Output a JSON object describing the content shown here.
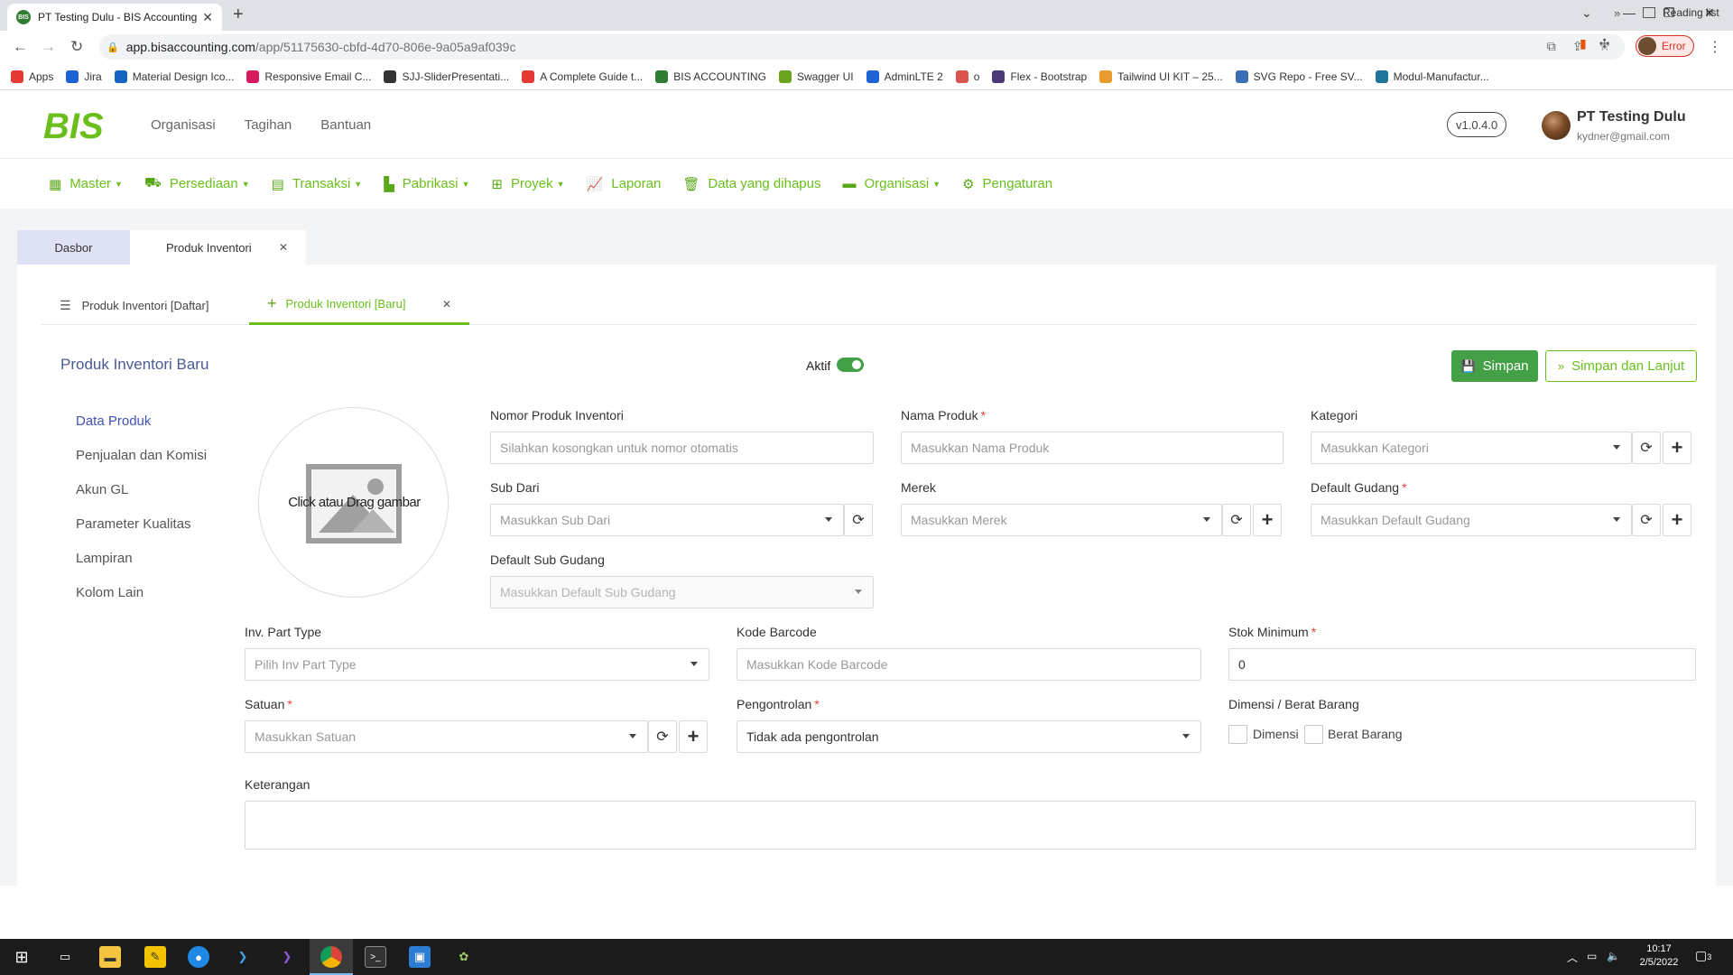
{
  "browser": {
    "tab_title": "PT Testing Dulu - BIS Accounting",
    "favicon_text": "BIS",
    "url_host": "app.bisaccounting.com",
    "url_path": "/app/51175630-cbfd-4d70-806e-9a05a9af039c",
    "profile_status": "Error",
    "bookmarks": [
      {
        "label": "Apps",
        "color": "#e53935"
      },
      {
        "label": "Jira",
        "color": "#1e63d6"
      },
      {
        "label": "Material Design Ico...",
        "color": "#1565c0"
      },
      {
        "label": "Responsive Email C...",
        "color": "#d81b60"
      },
      {
        "label": "SJJ-SliderPresentati...",
        "color": "#333333"
      },
      {
        "label": "A Complete Guide t...",
        "color": "#e53935"
      },
      {
        "label": "BIS ACCOUNTING",
        "color": "#2e7d32"
      },
      {
        "label": "Swagger UI",
        "color": "#6aa41e"
      },
      {
        "label": "AdminLTE 2",
        "color": "#1e63d6"
      },
      {
        "label": "o",
        "color": "#d9534f"
      },
      {
        "label": "Flex - Bootstrap",
        "color": "#4a3a78"
      },
      {
        "label": "Tailwind UI KIT – 25...",
        "color": "#e89a2b"
      },
      {
        "label": "SVG Repo - Free SV...",
        "color": "#3c6eb4"
      },
      {
        "label": "Modul-Manufactur...",
        "color": "#21759b"
      }
    ],
    "reading_list": "Reading list"
  },
  "app": {
    "logo_text": "BIS",
    "top_nav": [
      "Organisasi",
      "Tagihan",
      "Bantuan"
    ],
    "version": "v1.0.4.0",
    "user": {
      "name": "PT Testing Dulu",
      "email": "kydner@gmail.com"
    },
    "accent_color": "#6abf1c",
    "menu": [
      {
        "label": "Master",
        "icon": "grid-icon",
        "glyph": "▦",
        "dropdown": true
      },
      {
        "label": "Persediaan",
        "icon": "cubes-icon",
        "glyph": "⛟",
        "dropdown": true
      },
      {
        "label": "Transaksi",
        "icon": "register-icon",
        "glyph": "▤",
        "dropdown": true
      },
      {
        "label": "Pabrikasi",
        "icon": "industry-icon",
        "glyph": "▙",
        "dropdown": true
      },
      {
        "label": "Proyek",
        "icon": "sitemap-icon",
        "glyph": "⊞",
        "dropdown": true
      },
      {
        "label": "Laporan",
        "icon": "line-chart-icon",
        "glyph": "📈",
        "dropdown": false
      },
      {
        "label": "Data yang dihapus",
        "icon": "trash-icon",
        "glyph": "🗑",
        "dropdown": false
      },
      {
        "label": "Organisasi",
        "icon": "building-icon",
        "glyph": "▬",
        "dropdown": true
      },
      {
        "label": "Pengaturan",
        "icon": "gear-icon",
        "glyph": "⚙",
        "dropdown": false
      }
    ],
    "page_tabs": {
      "dasbor": "Dasbor",
      "produk": "Produk Inventori"
    },
    "sub_tabs": {
      "list": "Produk Inventori [Daftar]",
      "new": "Produk Inventori [Baru]"
    }
  },
  "form": {
    "title": "Produk Inventori Baru",
    "aktif_label": "Aktif",
    "aktif_on": true,
    "save_label": "Simpan",
    "save_next_label": "Simpan dan Lanjut",
    "side_menu": [
      "Data Produk",
      "Penjualan dan Komisi",
      "Akun GL",
      "Parameter Kualitas",
      "Lampiran",
      "Kolom Lain"
    ],
    "image_drop_text": "Click atau Drag gambar",
    "fields": {
      "nomor": {
        "label": "Nomor Produk Inventori",
        "placeholder": "Silahkan kosongkan untuk nomor otomatis"
      },
      "nama": {
        "label": "Nama Produk",
        "placeholder": "Masukkan Nama Produk",
        "required": "*"
      },
      "kategori": {
        "label": "Kategori",
        "placeholder": "Masukkan Kategori"
      },
      "sub_dari": {
        "label": "Sub Dari",
        "placeholder": "Masukkan Sub Dari"
      },
      "merek": {
        "label": "Merek",
        "placeholder": "Masukkan Merek"
      },
      "default_gudang": {
        "label": "Default Gudang",
        "placeholder": "Masukkan Default Gudang",
        "required": "*"
      },
      "default_sub_gudang": {
        "label": "Default Sub Gudang",
        "placeholder": "Masukkan Default Sub Gudang"
      },
      "inv_part_type": {
        "label": "Inv. Part Type",
        "placeholder": "Pilih Inv Part Type"
      },
      "kode_barcode": {
        "label": "Kode Barcode",
        "placeholder": "Masukkan Kode Barcode"
      },
      "stok_minimum": {
        "label": "Stok Minimum",
        "value": "0",
        "required": "*"
      },
      "satuan": {
        "label": "Satuan",
        "placeholder": "Masukkan Satuan",
        "required": "*"
      },
      "pengontrolan": {
        "label": "Pengontrolan",
        "value": "Tidak ada pengontrolan",
        "required": "*"
      },
      "dimensi_berat": {
        "label": "Dimensi / Berat Barang",
        "dimensi": "Dimensi",
        "berat": "Berat Barang"
      },
      "keterangan": {
        "label": "Keterangan"
      }
    }
  },
  "taskbar": {
    "time": "10:17",
    "date": "2/5/2022",
    "notifications": "3"
  }
}
